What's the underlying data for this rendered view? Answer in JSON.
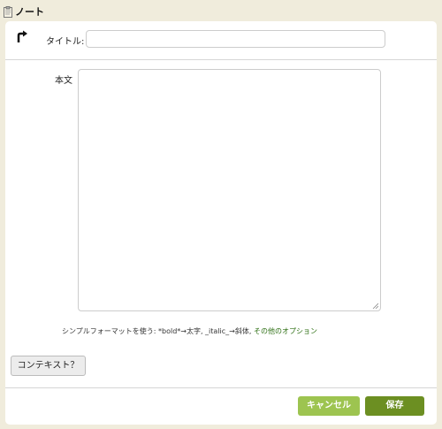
{
  "window": {
    "title": "ノート",
    "title_icon": "clipboard-icon"
  },
  "form": {
    "forward_icon": "turn-right-arrow-icon",
    "title_label": "タイトル:",
    "title_value": "",
    "body_label": "本文",
    "body_value": "",
    "format_hint": "シンプルフォーマットを使う: *bold*→太字, _italic_→斜体,",
    "format_link": "その他のオプション"
  },
  "buttons": {
    "context": "コンテキスト？",
    "cancel": "キャンセル",
    "save": "保存"
  },
  "colors": {
    "page_background": "#f0ecdc",
    "cancel_button": "#9dc450",
    "save_button": "#6c8f22",
    "link": "#2c6e12"
  }
}
